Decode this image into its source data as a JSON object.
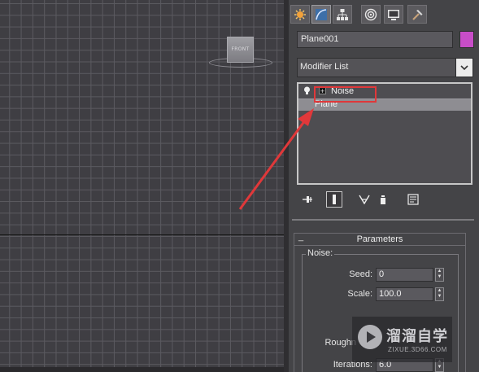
{
  "viewport": {
    "viewcube_label": "FRONT"
  },
  "command_panel": {
    "tabs": [
      {
        "name": "create",
        "icon": "create-sun-icon",
        "active": false
      },
      {
        "name": "modify",
        "icon": "modify-curve-icon",
        "active": true
      },
      {
        "name": "hierarchy",
        "icon": "hierarchy-icon",
        "active": false
      },
      {
        "name": "motion",
        "icon": "motion-icon",
        "active": false
      },
      {
        "name": "display",
        "icon": "display-monitor-icon",
        "active": false
      },
      {
        "name": "utilities",
        "icon": "utilities-hammer-icon",
        "active": false
      }
    ],
    "object_name": "Plane001",
    "object_color": "#c84dc8",
    "modifier_list_label": "Modifier List",
    "stack": {
      "items": [
        {
          "label": "Noise",
          "type": "modifier"
        },
        {
          "label": "Plane",
          "type": "base-object",
          "selected": true
        }
      ]
    },
    "parameters": {
      "rollout_toggle": "_",
      "rollout_title": "Parameters",
      "group_label": "Noise:",
      "seed_label": "Seed:",
      "seed_value": "0",
      "scale_label": "Scale:",
      "scale_value": "100.0",
      "roughness_label": "Roughn",
      "iterations_label": "Iterations:",
      "iterations_value": "6.0"
    }
  },
  "watermark": {
    "title": "溜溜自学",
    "subtitle": "ZIXUE.3D66.COM"
  },
  "annotation": {
    "color": "#e0383a"
  }
}
